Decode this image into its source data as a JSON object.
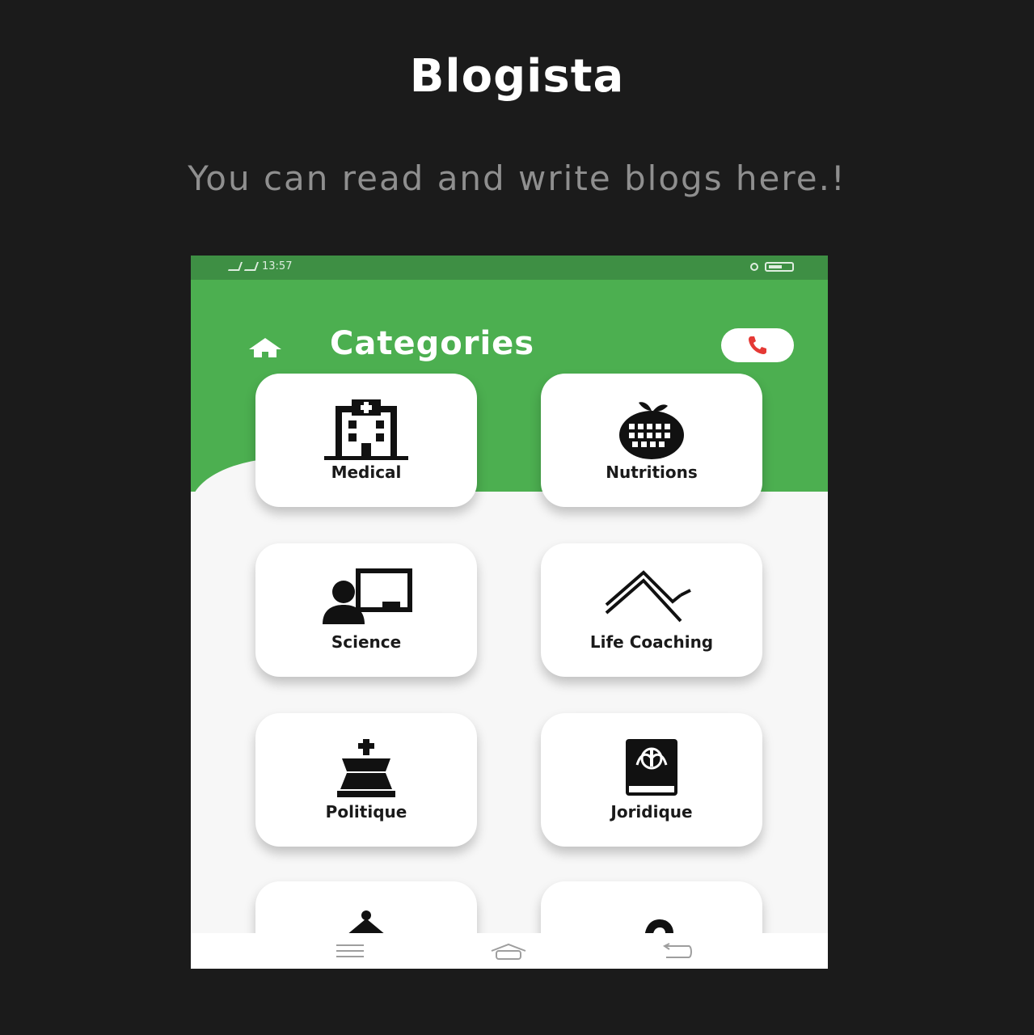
{
  "page": {
    "brand": "Blogista",
    "tagline": "You can read and write blogs here.!"
  },
  "status_bar": {
    "time": "13:57"
  },
  "app_bar": {
    "title": "Categories",
    "home_icon": "home-icon",
    "call_icon": "phone-icon"
  },
  "categories": [
    {
      "label": "Medical",
      "icon": "hospital-icon"
    },
    {
      "label": "Nutritions",
      "icon": "apple-icon"
    },
    {
      "label": "Science",
      "icon": "teacher-board-icon"
    },
    {
      "label": "Life Coaching",
      "icon": "zigzag-trend-icon"
    },
    {
      "label": "Politique",
      "icon": "chess-king-icon"
    },
    {
      "label": "Joridique",
      "icon": "law-book-icon"
    },
    {
      "label": "",
      "icon": "bell-icon"
    },
    {
      "label": "",
      "icon": "hook-icon"
    }
  ],
  "nav_bar": {
    "menu_icon": "menu-icon",
    "home_icon": "home-outline-icon",
    "back_icon": "back-icon"
  },
  "colors": {
    "background": "#1b1b1b",
    "header_green": "#4caf50",
    "status_green": "#3e8f44",
    "call_red": "#e53935"
  }
}
